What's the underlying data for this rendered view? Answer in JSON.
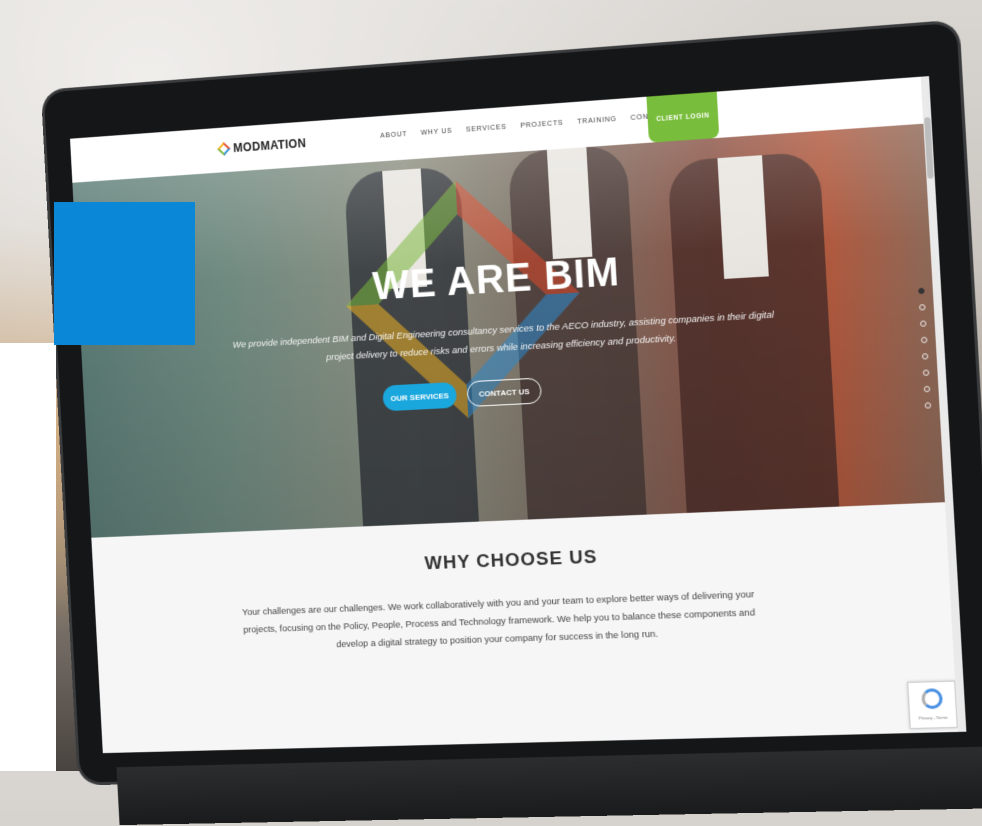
{
  "brand": {
    "name": "MODMATION"
  },
  "nav": {
    "items": [
      "ABOUT",
      "WHY US",
      "SERVICES",
      "PROJECTS",
      "TRAINING",
      "CONTACT"
    ],
    "login_label": "CLIENT LOGIN"
  },
  "hero": {
    "title": "WE ARE BIM",
    "subtitle": "We provide independent BIM and Digital Engineering consultancy services to the AECO industry, assisting companies in their digital project delivery to reduce risks and errors while increasing efficiency and productivity.",
    "primary_button": "OUR SERVICES",
    "secondary_button": "CONTACT US",
    "slides_count": 8,
    "active_slide": 1
  },
  "why": {
    "title": "WHY CHOOSE US",
    "text": "Your challenges are our challenges. We work collaboratively with you and your team to explore better ways of delivering your projects, focusing on the Policy, People, Process and Technology framework. We help you to balance these components and develop a digital strategy to position your company for success in the long run."
  },
  "recaptcha": {
    "label": "Privacy - Terms"
  },
  "colors": {
    "login_green": "#78bd3b",
    "services_blue": "#1aa7dd",
    "overlay_blue": "#0a87d6",
    "logo_red": "#e24a2b",
    "logo_blue": "#2f8fd6",
    "logo_yellow": "#f5b623",
    "logo_green": "#79b83a"
  },
  "icons": {
    "logo": "diamond-logo-icon",
    "recaptcha": "recaptcha-icon"
  }
}
